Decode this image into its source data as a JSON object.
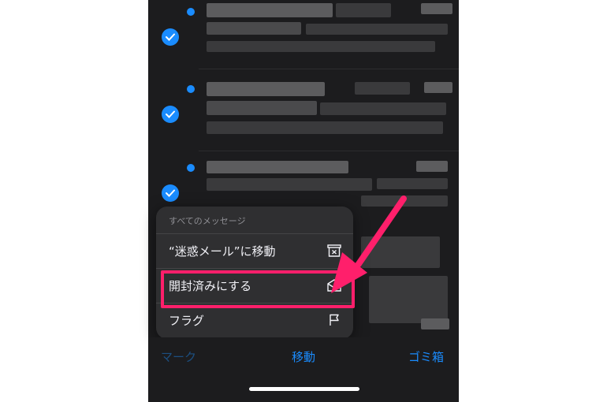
{
  "menu": {
    "header": "すべてのメッセージ",
    "items": [
      {
        "label": "“迷惑メール”に移動",
        "icon": "junk-bin-icon"
      },
      {
        "label": "開封済みにする",
        "icon": "envelope-open-icon"
      },
      {
        "label": "フラグ",
        "icon": "flag-icon"
      }
    ]
  },
  "toolbar": {
    "mark": "マーク",
    "move": "移動",
    "trash": "ゴミ箱"
  },
  "colors": {
    "accent": "#1a8cff",
    "highlight": "#ff1f6b",
    "background": "#1c1c1e",
    "menu_bg": "#2f2f31"
  }
}
